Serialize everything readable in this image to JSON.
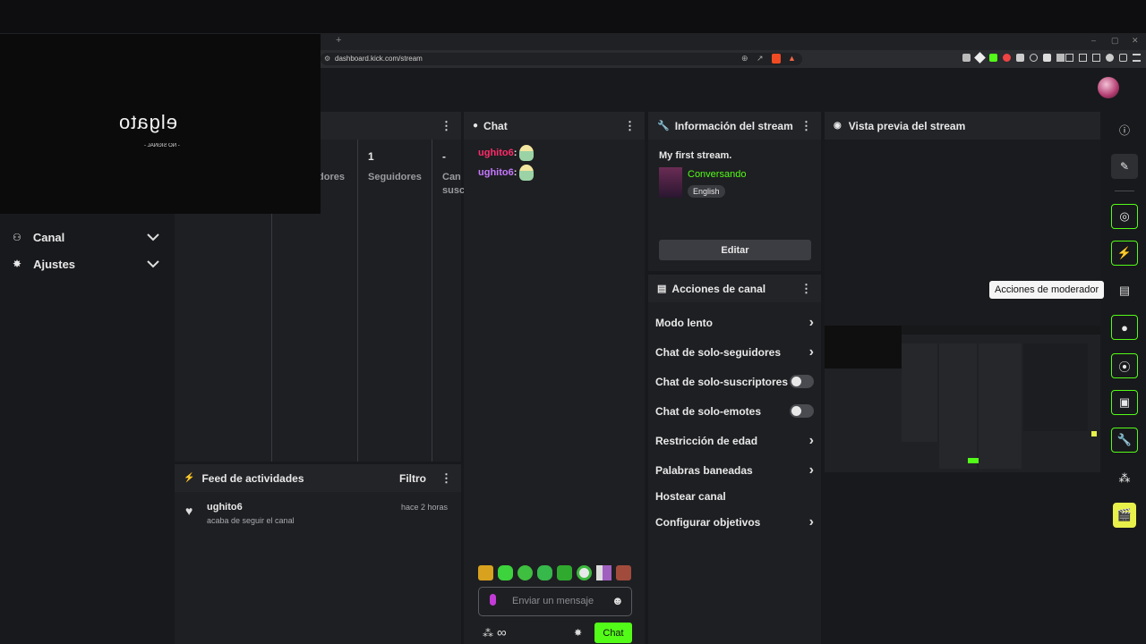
{
  "browser": {
    "url": "dashboard.kick.com/stream",
    "new_tab": "+",
    "win_min": "–",
    "win_max": "▢",
    "win_close": "✕"
  },
  "elgato": {
    "brand": "elgato",
    "caption": "- NO SIGNAL -"
  },
  "sidebar": {
    "items": [
      {
        "label": "Canal"
      },
      {
        "label": "Ajustes"
      }
    ]
  },
  "stats": {
    "cells": [
      {
        "value": "",
        "label": "dores"
      },
      {
        "value": "1",
        "label": "Seguidores"
      },
      {
        "value": "-",
        "label": "Can"
      }
    ],
    "extra_label": "susc"
  },
  "activity": {
    "title": "Feed de actividades",
    "filter": "Filtro",
    "items": [
      {
        "user": "ughito6",
        "text": "acaba de seguir el canal",
        "time": "hace 2 horas"
      }
    ]
  },
  "chat": {
    "title": "Chat",
    "messages": [
      {
        "user": "ughito6",
        "color": "#ff2b6a"
      },
      {
        "user": "ughito6",
        "color": "#c678ff"
      }
    ],
    "placeholder": "Enviar un mensaje",
    "send": "Chat"
  },
  "stream_info": {
    "title": "Información del stream",
    "stream_title": "My first stream.",
    "category": "Conversando",
    "language": "English",
    "edit": "Editar"
  },
  "channel_actions": {
    "title": "Acciones de canal",
    "items": [
      {
        "label": "Modo lento",
        "control": "chevron"
      },
      {
        "label": "Chat de solo-seguidores",
        "control": "chevron"
      },
      {
        "label": "Chat de solo-suscriptores",
        "control": "toggle"
      },
      {
        "label": "Chat de solo-emotes",
        "control": "toggle"
      },
      {
        "label": "Restricción de edad",
        "control": "chevron"
      },
      {
        "label": "Palabras baneadas",
        "control": "chevron"
      },
      {
        "label": "Hostear canal",
        "control": "none"
      },
      {
        "label": "Configurar objetivos",
        "control": "chevron"
      }
    ]
  },
  "preview": {
    "title": "Vista previa del stream"
  },
  "tooltip": {
    "text": "Acciones de moderador"
  },
  "colors": {
    "accent": "#53fc18",
    "bg": "#18191c",
    "panel": "#1e1f22",
    "header": "#232428"
  }
}
